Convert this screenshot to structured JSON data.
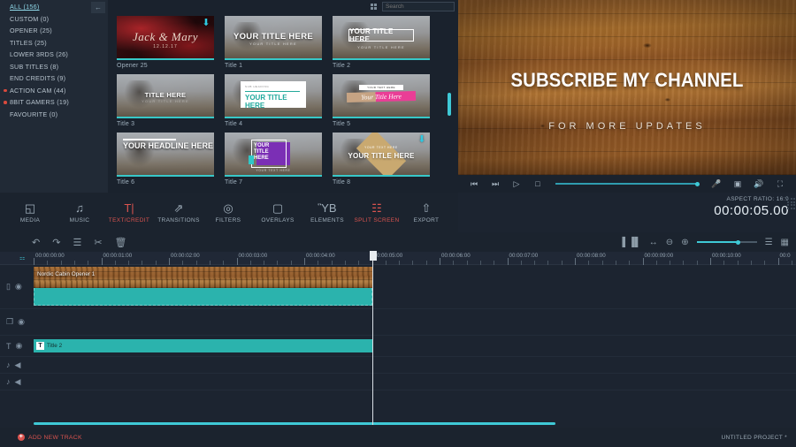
{
  "categories": [
    {
      "label": "ALL (156)",
      "active": true,
      "dot": false
    },
    {
      "label": "CUSTOM (0)",
      "active": false,
      "dot": false
    },
    {
      "label": "OPENER (25)",
      "active": false,
      "dot": false
    },
    {
      "label": "TITLES (25)",
      "active": false,
      "dot": false
    },
    {
      "label": "LOWER 3RDS (26)",
      "active": false,
      "dot": false
    },
    {
      "label": "SUB TITLES (8)",
      "active": false,
      "dot": false
    },
    {
      "label": "END CREDITS (9)",
      "active": false,
      "dot": false
    },
    {
      "label": "ACTION CAM (44)",
      "active": false,
      "dot": true
    },
    {
      "label": "8BIT GAMERS (19)",
      "active": false,
      "dot": true
    },
    {
      "label": "FAVOURITE (0)",
      "active": false,
      "dot": false
    }
  ],
  "sidebar": {
    "collapse_icon": "←"
  },
  "browse": {
    "search_placeholder": "Search",
    "search_value": "",
    "search_icon": "⌕",
    "thumbnails": [
      {
        "label": "Opener 25",
        "title": "Jack & Mary",
        "date": "12.12.17",
        "download": true
      },
      {
        "label": "Title 1",
        "title": "YOUR TITLE HERE",
        "sub": "YOUR TITLE HERE",
        "download": false
      },
      {
        "label": "Title 2",
        "title": "YOUR TITLE HERE",
        "sub": "YOUR TITLE HERE",
        "download": false
      },
      {
        "label": "Title 3",
        "title": "TITLE HERE",
        "sub": "YOUR TITLE HERE",
        "download": false
      },
      {
        "label": "Title 4",
        "title": "YOUR TITLE HERE",
        "sub": "SUB HEADING",
        "download": false
      },
      {
        "label": "Title 5",
        "title": "Your Title Here",
        "sub": "YOUR TEXT HERE",
        "download": false
      },
      {
        "label": "Title 6",
        "title": "YOUR HEADLINE HERE",
        "sub": "",
        "download": false
      },
      {
        "label": "Title 7",
        "title": "YOUR TITLE HERE",
        "sub": "YOUR TEXT HERE",
        "download": false
      },
      {
        "label": "Title 8",
        "title": "YOUR TITLE HERE",
        "sub": "YOUR TEXT HERE",
        "download": true
      }
    ]
  },
  "preview": {
    "title": "SUBSCRIBE MY CHANNEL",
    "subtitle": "FOR MORE UPDATES",
    "transport": [
      {
        "name": "skip-start",
        "glyph": "⏮"
      },
      {
        "name": "skip-end",
        "glyph": "⏭"
      },
      {
        "name": "play",
        "glyph": "▷"
      },
      {
        "name": "stop",
        "glyph": "□"
      }
    ],
    "tools": [
      {
        "name": "microphone",
        "glyph": "Ἲ4"
      },
      {
        "name": "snapshot",
        "glyph": "▣"
      },
      {
        "name": "volume",
        "glyph": "◁"
      },
      {
        "name": "fullscreen",
        "glyph": "⛶"
      }
    ],
    "aspect_ratio": "ASPECT RATIO: 16:9",
    "timecode": "00:00:05.00"
  },
  "toolbar": {
    "tabs": [
      {
        "label": "MEDIA",
        "icon": "◱",
        "accent": false
      },
      {
        "label": "MUSIC",
        "icon": "♫",
        "accent": false
      },
      {
        "label": "TEXT/CREDIT",
        "icon": "T|",
        "accent": true
      },
      {
        "label": "TRANSITIONS",
        "icon": "⇗",
        "accent": false
      },
      {
        "label": "FILTERS",
        "icon": "◎",
        "accent": false
      },
      {
        "label": "OVERLAYS",
        "icon": "▢",
        "accent": false
      },
      {
        "label": "ELEMENTS",
        "icon": "ὛB",
        "accent": false
      },
      {
        "label": "SPLIT SCREEN",
        "icon": "☷",
        "accent": true
      },
      {
        "label": "EXPORT",
        "icon": "⇧",
        "accent": false
      }
    ]
  },
  "timeline_toolbar": {
    "left_icons": [
      {
        "name": "undo",
        "glyph": "↶"
      },
      {
        "name": "redo",
        "glyph": "↷"
      },
      {
        "name": "list",
        "glyph": "☰"
      },
      {
        "name": "cut",
        "glyph": "✂"
      },
      {
        "name": "delete",
        "glyph": "Ὕ1"
      }
    ],
    "right_icons": [
      {
        "name": "audio-waveform",
        "glyph": "⩝"
      },
      {
        "name": "fit-to-screen",
        "glyph": "↔"
      },
      {
        "name": "zoom-out",
        "glyph": "⊖"
      },
      {
        "name": "zoom-in",
        "glyph": "⊕"
      }
    ],
    "end_icons": [
      {
        "name": "list-view",
        "glyph": "☰"
      },
      {
        "name": "grid-view",
        "glyph": "▦"
      }
    ]
  },
  "ruler": {
    "snap_icon": "⚏",
    "ticks": [
      "00:00:00:00",
      "00:00:01:00",
      "00:00:02:00",
      "00:00:03:00",
      "00:00:04:00",
      "00:00:05:00",
      "00:00:06:00",
      "00:00:07:00",
      "00:00:08:00",
      "00:00:09:00",
      "00:00:10:00",
      "00:0"
    ]
  },
  "tracks": [
    {
      "name": "video-track",
      "head_icons": [
        {
          "name": "film",
          "glyph": "▯"
        },
        {
          "name": "eye",
          "glyph": "◉"
        }
      ],
      "clip": {
        "type": "video",
        "name": "Nordic Cabin Opener 1"
      }
    },
    {
      "name": "pip-track",
      "head_icons": [
        {
          "name": "layers",
          "glyph": "❐"
        },
        {
          "name": "eye",
          "glyph": "◉"
        }
      ],
      "clip": null
    },
    {
      "name": "text-track",
      "head_icons": [
        {
          "name": "text-t",
          "glyph": "T"
        },
        {
          "name": "eye",
          "glyph": "◉"
        }
      ],
      "clip": {
        "type": "text",
        "name": "Title 2",
        "icon": "T"
      }
    },
    {
      "name": "audio-track-1",
      "head_icons": [
        {
          "name": "music-note",
          "glyph": "♪"
        },
        {
          "name": "speaker",
          "glyph": "◀"
        }
      ],
      "clip": null
    },
    {
      "name": "audio-track-2",
      "head_icons": [
        {
          "name": "music-note",
          "glyph": "♪"
        },
        {
          "name": "speaker",
          "glyph": "◀"
        }
      ],
      "clip": null
    }
  ],
  "statusbar": {
    "add_track_label": "ADD NEW TRACK",
    "add_track_icon": "+",
    "project_name": "UNTITLED PROJECT *"
  },
  "colors": {
    "accent_teal": "#3fc9d6",
    "accent_red": "#d9534f",
    "clip_teal": "#2bb3ad",
    "bg_dark": "#1c2430"
  }
}
